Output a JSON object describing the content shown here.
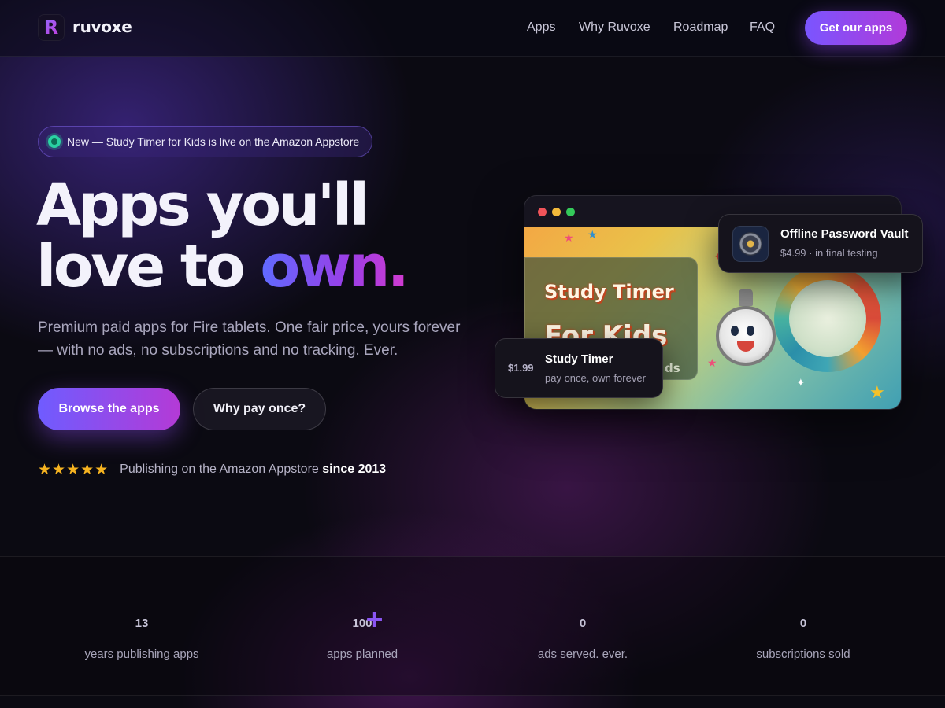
{
  "brand": {
    "logo_letter": "R",
    "name": "ruvoxe"
  },
  "nav": {
    "links": [
      "Apps",
      "Why Ruvoxe",
      "Roadmap",
      "FAQ"
    ],
    "cta": "Get our apps"
  },
  "hero": {
    "badge": "New — Study Timer for Kids is live on the Amazon Appstore",
    "headline_line1": "Apps you'll",
    "headline_line2_plain": "love to ",
    "headline_line2_accent": "own.",
    "subtitle": "Premium paid apps for Fire tablets. One fair price, yours forever — with no ads, no subscriptions and no tracking. Ever.",
    "primary_button": "Browse the apps",
    "secondary_button": "Why pay once?",
    "stars": "★★★★★",
    "rating_text": "Publishing on the Amazon Appstore",
    "rating_emphasis": "since 2013"
  },
  "showcase": {
    "art_title_line1": "Study Timer",
    "art_title_line2": "For Kids",
    "art_title_fragment": "ds",
    "vault_card": {
      "title": "Offline Password Vault",
      "subtitle": "$4.99 · in final testing",
      "icon": "vault-dial-icon"
    },
    "timer_card": {
      "price": "$1.99",
      "title": "Study Timer",
      "subtitle": "pay once, own forever"
    }
  },
  "stats": [
    {
      "value": "13",
      "label": "years publishing apps"
    },
    {
      "value": "100",
      "suffix": "+",
      "label": "apps planned"
    },
    {
      "value": "0",
      "label": "ads served. ever."
    },
    {
      "value": "0",
      "label": "subscriptions sold"
    }
  ],
  "colors": {
    "accent_start": "#7a55ff",
    "accent_end": "#b13ad9",
    "background": "#0b0a12",
    "status_green": "#2ad2a2",
    "star": "#f6b320"
  }
}
